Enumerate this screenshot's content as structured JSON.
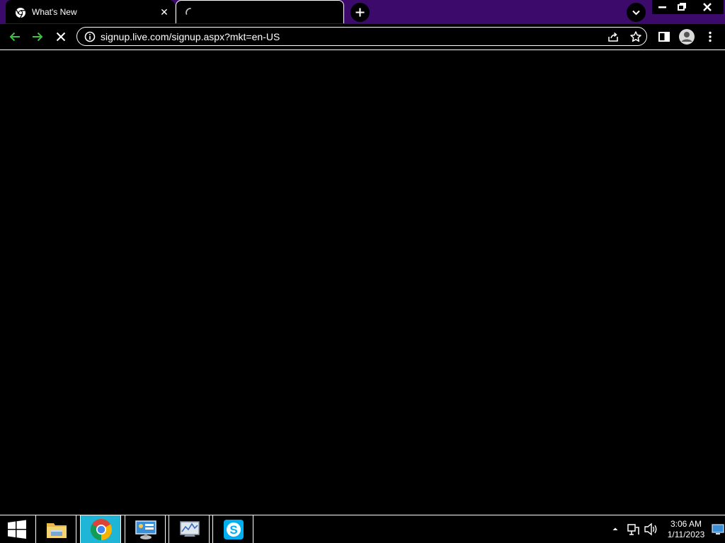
{
  "browser": {
    "tabs": [
      {
        "title": "What's New",
        "state": "inactive"
      },
      {
        "title": "",
        "state": "loading"
      }
    ],
    "new_tab_icon": "plus-icon",
    "tab_search_icon": "chevron-down-icon",
    "address": "signup.live.com/signup.aspx?mkt=en-US",
    "nav_icons": [
      "back-arrow-icon",
      "forward-arrow-icon",
      "stop-icon"
    ],
    "omnibox_icons": [
      "info-icon",
      "share-icon",
      "star-icon"
    ],
    "toolbar_icons": [
      "side-panel-icon",
      "profile-icon",
      "kebab-menu-icon"
    ],
    "accent_colors": {
      "tab_strip": "#3b0a6b",
      "nav_arrows": "#3ec13e",
      "taskbar_active": "#1fb5d6"
    }
  },
  "taskbar": {
    "apps": [
      "file-explorer-icon",
      "chrome-icon",
      "control-panel-icon",
      "performance-monitor-icon",
      "skype-icon"
    ],
    "clock": {
      "time": "3:06 AM",
      "date": "1/11/2023"
    },
    "tray_icons": [
      "tray-chevron-icon",
      "network-icon",
      "volume-icon",
      "show-desktop-icon"
    ]
  }
}
